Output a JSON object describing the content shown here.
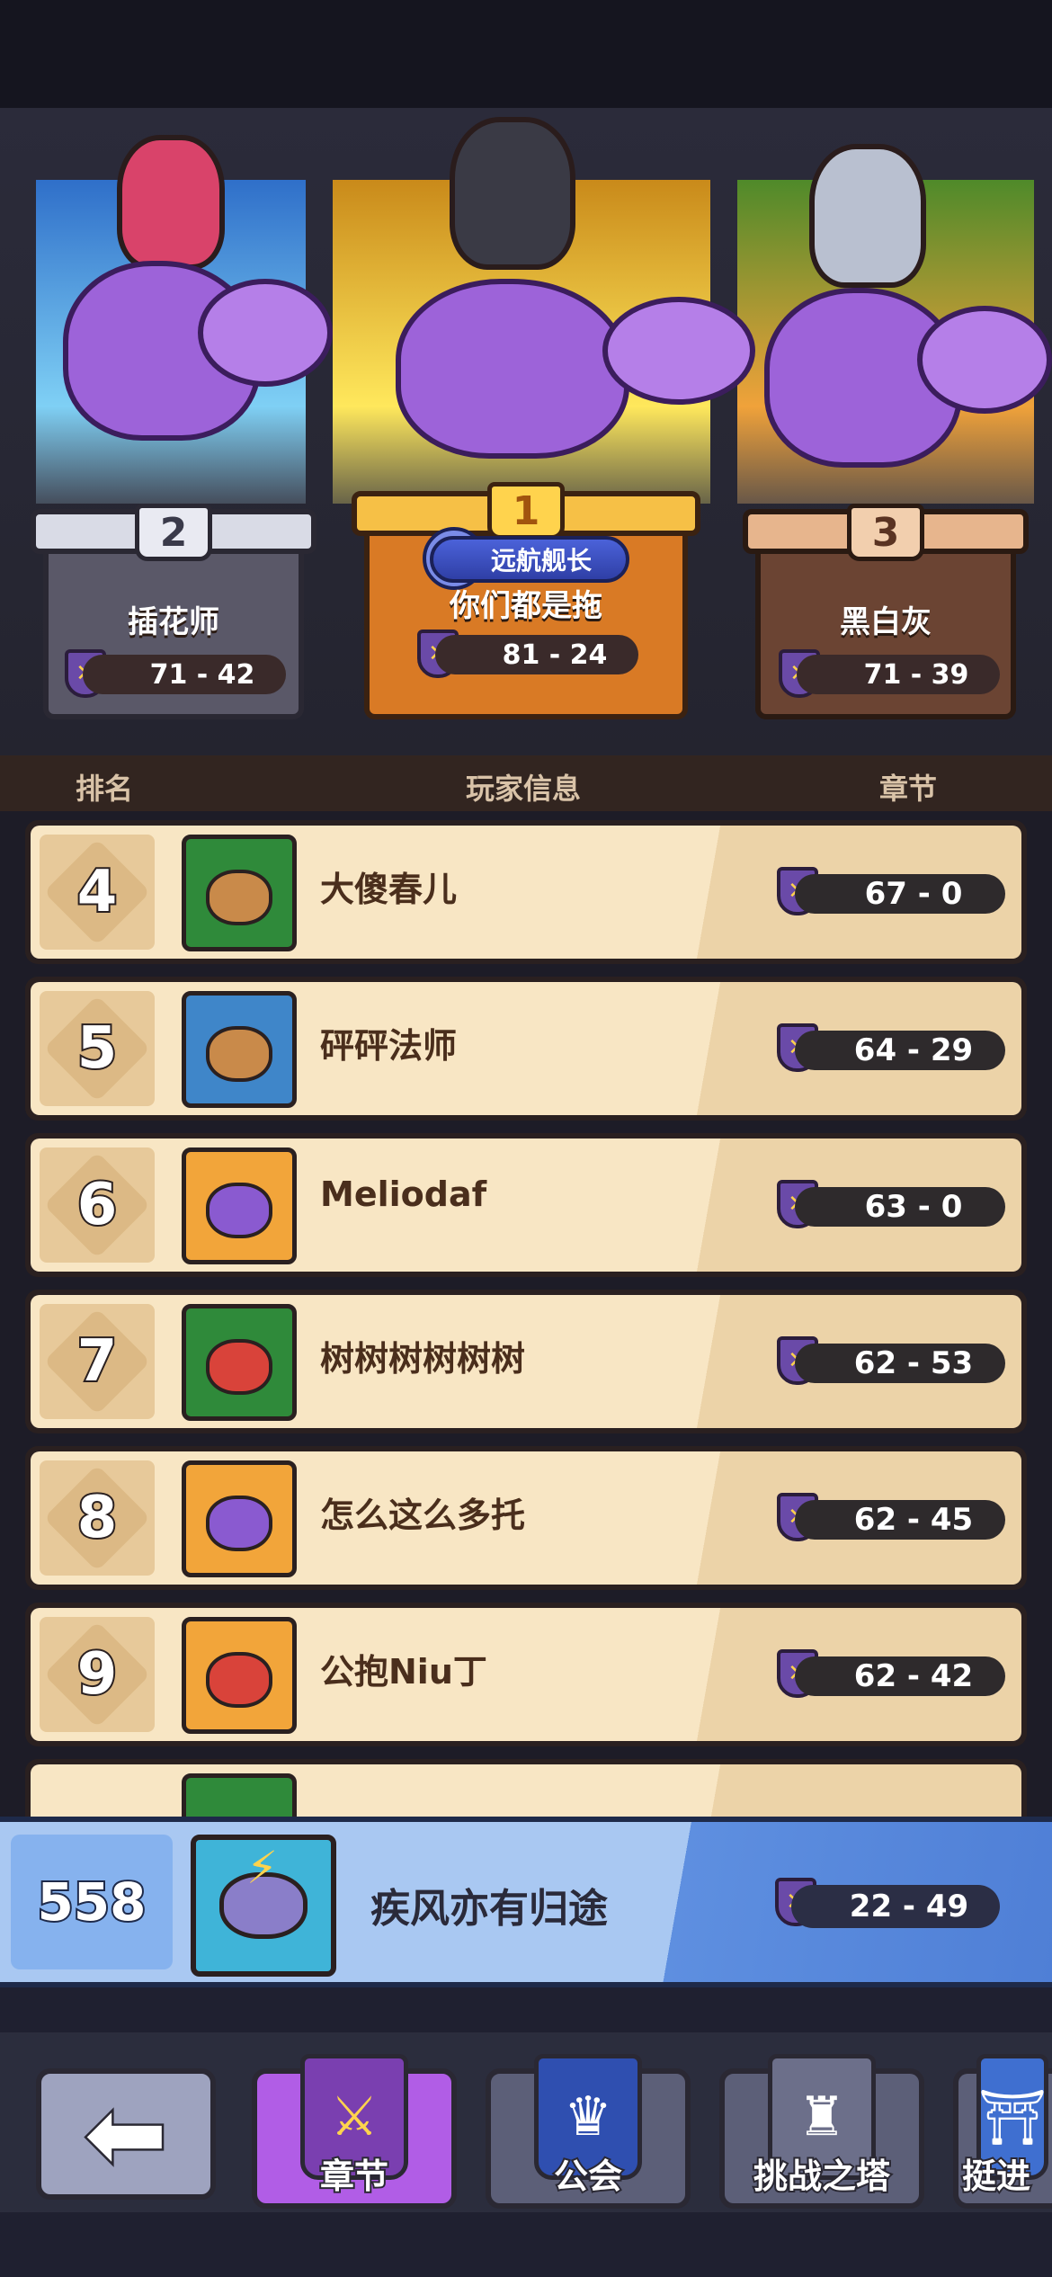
{
  "podium": [
    {
      "rank": "2",
      "name": "插花师",
      "score": "71 - 42"
    },
    {
      "rank": "1",
      "name": "你们都是拖",
      "score": "81 - 24",
      "title_badge": "远航舰长"
    },
    {
      "rank": "3",
      "name": "黑白灰",
      "score": "71 - 39"
    }
  ],
  "list_header": {
    "rank": "排名",
    "player_info": "玩家信息",
    "chapter": "章节"
  },
  "rows": [
    {
      "rank": "4",
      "name": "大傻春儿",
      "score": "67 - 0",
      "avatar_color": "#2f8a3a"
    },
    {
      "rank": "5",
      "name": "砰砰法师",
      "score": "64 - 29",
      "avatar_color": "#3f86c9"
    },
    {
      "rank": "6",
      "name": "Meliodaf",
      "score": "63 - 0",
      "avatar_color": "#f2a53a"
    },
    {
      "rank": "7",
      "name": "树树树树树树",
      "score": "62 - 53",
      "avatar_color": "#2f8a3a"
    },
    {
      "rank": "8",
      "name": "怎么这么多托",
      "score": "62 - 45",
      "avatar_color": "#f2a53a"
    },
    {
      "rank": "9",
      "name": "公抱Niu丁",
      "score": "62 - 42",
      "avatar_color": "#f2a53a"
    }
  ],
  "my_rank": {
    "rank": "558",
    "name": "疾风亦有归途",
    "score": "22 - 49"
  },
  "nav": {
    "back_icon": "arrow-left-icon",
    "tabs": [
      {
        "label": "章节",
        "active": true
      },
      {
        "label": "公会",
        "active": false
      },
      {
        "label": "挑战之塔",
        "active": false
      },
      {
        "label": "挺进",
        "active": false
      }
    ]
  }
}
